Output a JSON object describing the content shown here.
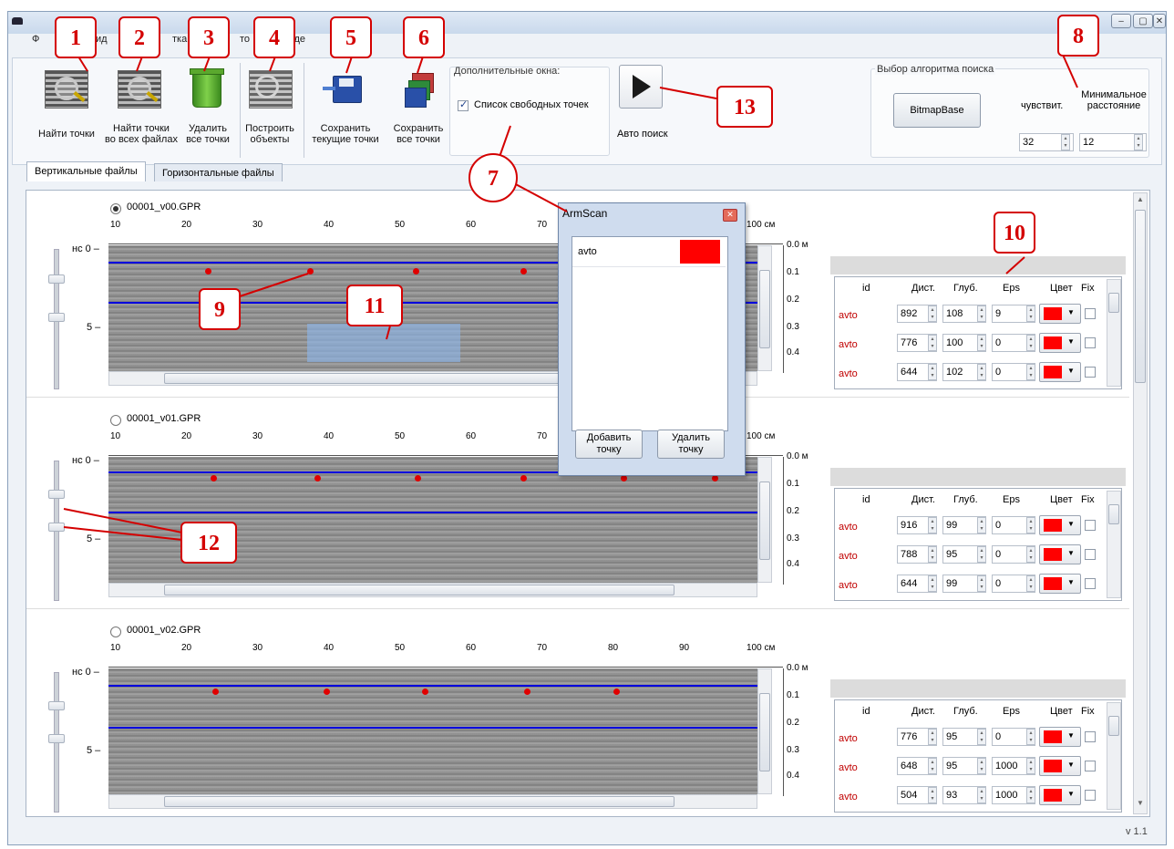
{
  "menu": {
    "items": [
      "Ф",
      "ид",
      "тка",
      "то",
      "моде"
    ]
  },
  "toolbar": {
    "find_points": "Найти точки",
    "find_points_all": "Найти точки\nво всех файлах",
    "delete_all": "Удалить\nвсе точки",
    "build_objects": "Построить\nобъекты",
    "save_current": "Сохранить\nтекущие точки",
    "save_all": "Сохранить\nвсе точки",
    "extra_windows_label": "Дополнительные окна:",
    "free_points_checkbox": "Список свободных точек",
    "auto_search": "Авто поиск",
    "algo_label": "Выбор алгоритма поиска",
    "algo_button": "BitmapBase",
    "sensitivity_label": "чувствит.",
    "min_distance_label": "Минимальное\nрасстояние",
    "sensitivity_value": "32",
    "min_distance_value": "12"
  },
  "tabs": {
    "vertical": "Вертикальные файлы",
    "horizontal": "Горизонтальные файлы"
  },
  "ruler": {
    "ticks": [
      "10",
      "20",
      "30",
      "40",
      "50",
      "60",
      "70",
      "80",
      "90",
      "100 см"
    ],
    "time_label": "нс 0 –",
    "five": "5 –"
  },
  "depth_ticks": [
    "0.0 м",
    "0.1",
    "0.2",
    "0.3",
    "0.4"
  ],
  "table_headers": [
    "id",
    "Дист.",
    "Глуб.",
    "Eps",
    "Цвет",
    "Fix"
  ],
  "files": [
    {
      "name": "00001_v00.GPR",
      "selected": true,
      "rows": [
        [
          "avto",
          "892",
          "108",
          "9"
        ],
        [
          "avto",
          "776",
          "100",
          "0"
        ],
        [
          "avto",
          "644",
          "102",
          "0"
        ]
      ]
    },
    {
      "name": "00001_v01.GPR",
      "selected": false,
      "rows": [
        [
          "avto",
          "916",
          "99",
          "0"
        ],
        [
          "avto",
          "788",
          "95",
          "0"
        ],
        [
          "avto",
          "644",
          "99",
          "0"
        ]
      ]
    },
    {
      "name": "00001_v02.GPR",
      "selected": false,
      "rows": [
        [
          "avto",
          "776",
          "95",
          "0"
        ],
        [
          "avto",
          "648",
          "95",
          "1000"
        ],
        [
          "avto",
          "504",
          "93",
          "1000"
        ]
      ]
    }
  ],
  "popup": {
    "title": "ArmScan",
    "item": "avto",
    "add_button": "Добавить\nточку",
    "delete_button": "Удалить\nточку"
  },
  "annotations": [
    "1",
    "2",
    "3",
    "4",
    "5",
    "6",
    "7",
    "8",
    "9",
    "10",
    "11",
    "12",
    "13"
  ],
  "version": "v 1.1",
  "colors": {
    "accent_red": "#d40000",
    "point_red": "#e00000",
    "line_blue": "#0000dd"
  }
}
